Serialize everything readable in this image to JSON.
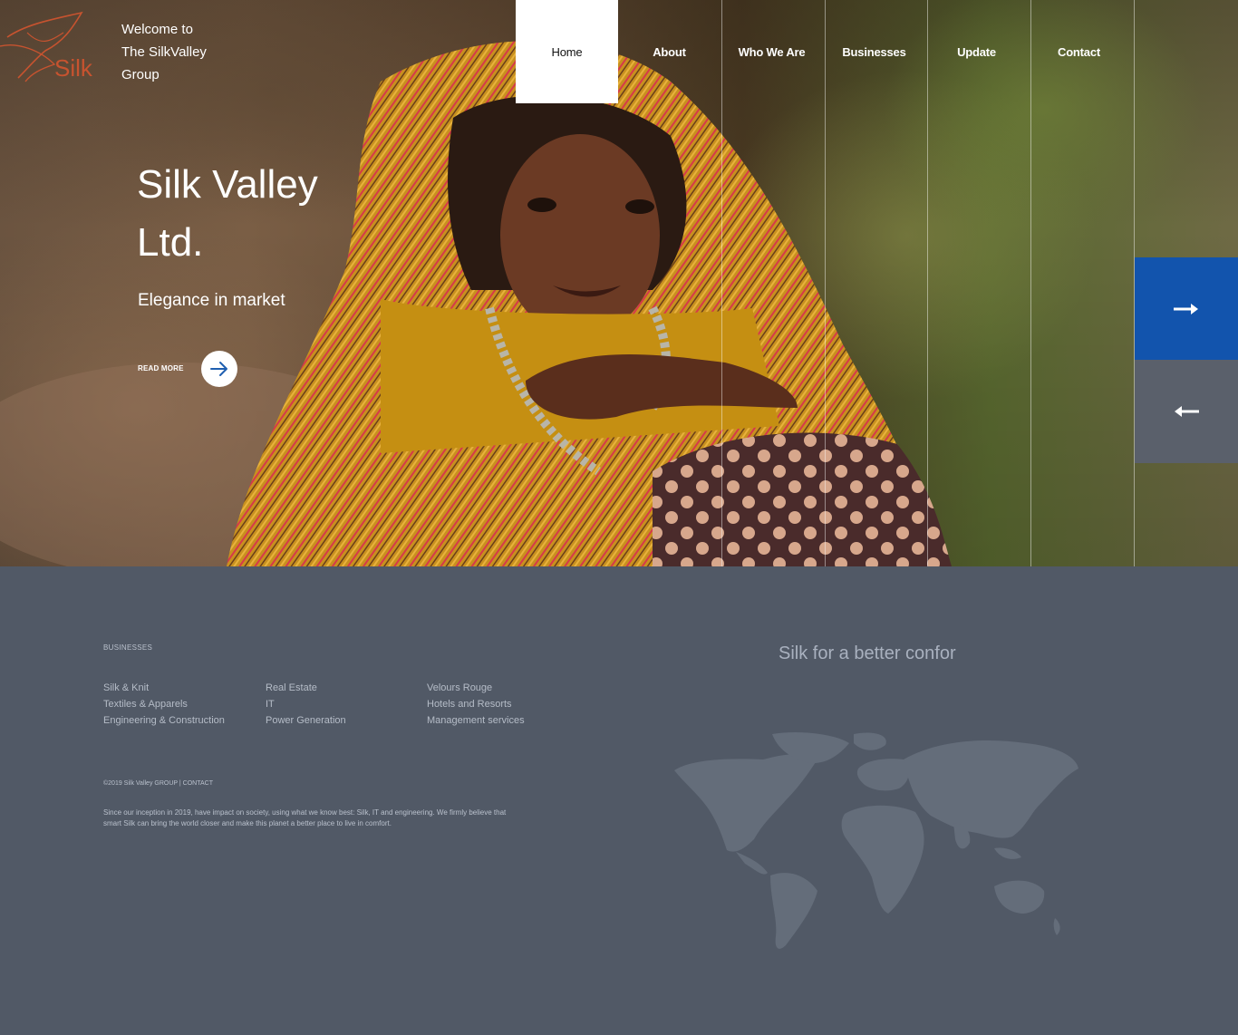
{
  "brand": {
    "logo_text": "Silk",
    "welcome_lines": [
      "Welcome to",
      "The SilkValley",
      "Group"
    ]
  },
  "nav": {
    "items": [
      {
        "label": "Home",
        "active": true
      },
      {
        "label": "About",
        "active": false
      },
      {
        "label": "Who We Are",
        "active": false
      },
      {
        "label": "Businesses",
        "active": false
      },
      {
        "label": "Update",
        "active": false
      },
      {
        "label": "Contact",
        "active": false
      }
    ]
  },
  "hero": {
    "title_line1": "Silk Valley",
    "title_line2": "Ltd.",
    "subtitle": "Elegance in market",
    "read_more": "READ MORE",
    "next_icon": "arrow-right-icon",
    "prev_icon": "arrow-left-icon",
    "accent_color": "#1254ad"
  },
  "footer": {
    "businesses_heading": "BUSINESSES",
    "columns": [
      [
        "Silk & Knit",
        "Textiles & Apparels",
        "Engineering & Construction"
      ],
      [
        "Real Estate",
        "IT",
        "Power Generation"
      ],
      [
        "Velours Rouge",
        "Hotels and Resorts",
        "Management services"
      ]
    ],
    "copyright": "©2019 Silk Valley GROUP",
    "contact_link": "CONTACT",
    "about": "Since our inception in 2019, have impact on society, using what we know best: Silk, IT and engineering. We firmly believe that smart Silk can bring the world closer and make this planet a better place to live in comfort.",
    "tagline": "Silk for a better confor",
    "background_color": "#515966"
  }
}
